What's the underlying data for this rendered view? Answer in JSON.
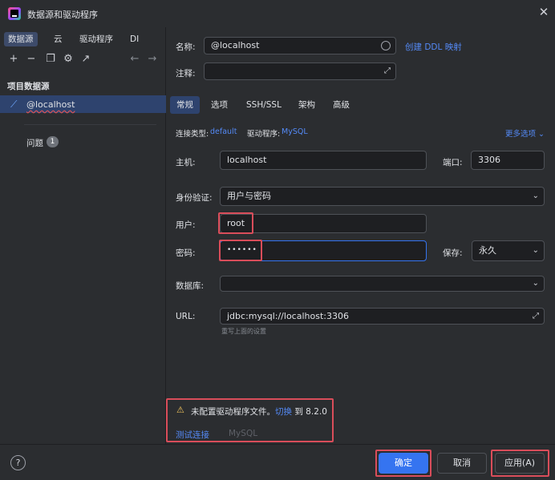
{
  "window": {
    "title": "数据源和驱动程序"
  },
  "left": {
    "tabs": [
      "数据源",
      "云",
      "驱动程序",
      "DI"
    ],
    "section_label": "项目数据源",
    "datasource": "@localhost",
    "problems_label": "问题",
    "problems_count": "1"
  },
  "form": {
    "name_label": "名称:",
    "name_value": "@localhost",
    "ddl_link": "创建 DDL 映射",
    "comment_label": "注释:",
    "tabs": [
      "常规",
      "选项",
      "SSH/SSL",
      "架构",
      "高级"
    ],
    "conn_type_label": "连接类型:",
    "conn_type_value": "default",
    "driver_label": "驱动程序:",
    "driver_value": "MySQL",
    "more_options": "更多选项",
    "host_label": "主机:",
    "host_value": "localhost",
    "port_label": "端口:",
    "port_value": "3306",
    "auth_label": "身份验证:",
    "auth_value": "用户与密码",
    "user_label": "用户:",
    "user_value": "root",
    "password_label": "密码:",
    "password_value": "••••••",
    "save_label": "保存:",
    "save_value": "永久",
    "database_label": "数据库:",
    "database_value": "",
    "url_label": "URL:",
    "url_value": "jdbc:mysql://localhost:3306",
    "url_hint": "重写上面的设置"
  },
  "warning": {
    "text": "未配置驱动程序文件。",
    "switch_link": "切换",
    "switch_suffix": "到 8.2.0",
    "test_link": "测试连接",
    "driver_name": "MySQL"
  },
  "buttons": {
    "help": "?",
    "ok": "确定",
    "cancel": "取消",
    "apply": "应用(A)"
  },
  "colors": {
    "accent": "#3574f0",
    "highlight": "#d94d5a",
    "background": "#2b2d30"
  }
}
